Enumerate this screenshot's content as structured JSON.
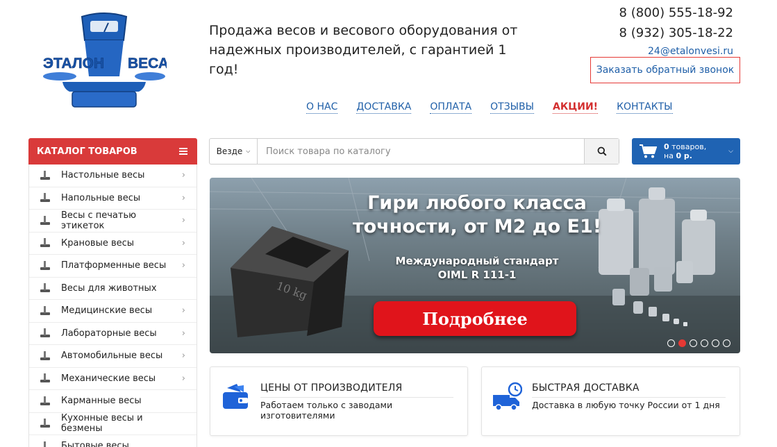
{
  "header": {
    "logo_text_left": "ЭТАЛОН",
    "logo_text_right": "ВЕСА",
    "tagline": "Продажа весов и весового оборудования от надежных производителей, с гарантией 1 год!",
    "phone_1": "8 (800) 555-18-92",
    "phone_2": "8 (932) 305-18-22",
    "email": "24@etalonvesi.ru",
    "callback_label": "Заказать обратный звонок"
  },
  "nav": {
    "items": [
      "О НАС",
      "ДОСТАВКА",
      "ОПЛАТА",
      "ОТЗЫВЫ",
      "АКЦИИ!",
      "КОНТАКТЫ"
    ]
  },
  "catalog": {
    "title": "КАТАЛОГ ТОВАРОВ",
    "items": [
      {
        "label": "Настольные весы",
        "icon": "tabletop-scale-icon",
        "has_sub": true
      },
      {
        "label": "Напольные весы",
        "icon": "floor-scale-icon",
        "has_sub": true
      },
      {
        "label": "Весы с печатью этикеток",
        "icon": "label-printer-scale-icon",
        "has_sub": true
      },
      {
        "label": "Крановые весы",
        "icon": "crane-scale-icon",
        "has_sub": true
      },
      {
        "label": "Платформенные весы",
        "icon": "platform-scale-icon",
        "has_sub": true
      },
      {
        "label": "Весы для животных",
        "icon": "animal-scale-icon",
        "has_sub": false
      },
      {
        "label": "Медицинские весы",
        "icon": "medical-scale-icon",
        "has_sub": true
      },
      {
        "label": "Лабораторные весы",
        "icon": "lab-scale-icon",
        "has_sub": true
      },
      {
        "label": "Автомобильные весы",
        "icon": "truck-scale-icon",
        "has_sub": true
      },
      {
        "label": "Механические весы",
        "icon": "mechanical-scale-icon",
        "has_sub": true
      },
      {
        "label": "Карманные весы",
        "icon": "pocket-scale-icon",
        "has_sub": false
      },
      {
        "label": "Кухонные весы и безмены",
        "icon": "kitchen-scale-icon",
        "has_sub": false
      },
      {
        "label": "Бытовые весы",
        "icon": "household-scale-icon",
        "has_sub": false
      }
    ]
  },
  "search": {
    "scope": "Везде",
    "placeholder": "Поиск товара по каталогу"
  },
  "cart": {
    "count": "0",
    "count_suffix": " товаров,",
    "sum_prefix": "на ",
    "sum": "0 р."
  },
  "banner": {
    "title": "Гири любого класса точности, от М2 до Е1!",
    "subtitle_line1": "Международный стандарт",
    "subtitle_line2": "OIML R 111-1",
    "button": "Подробнее",
    "weight_marking": "10 kg",
    "slides": 6,
    "active_slide": 2
  },
  "features": [
    {
      "title": "ЦЕНЫ ОТ ПРОИЗВОДИТЕЛЯ",
      "text": "Работаем только с заводами изготовителями",
      "icon": "wallet-icon"
    },
    {
      "title": "БЫСТРАЯ ДОСТАВКА",
      "text": "Доставка в любую точку России от 1 дня",
      "icon": "delivery-truck-icon"
    }
  ],
  "colors": {
    "accent_red": "#d93a3a",
    "link_blue": "#1f5fa8",
    "cart_blue": "#1f63b3",
    "button_red": "#e0141b"
  }
}
